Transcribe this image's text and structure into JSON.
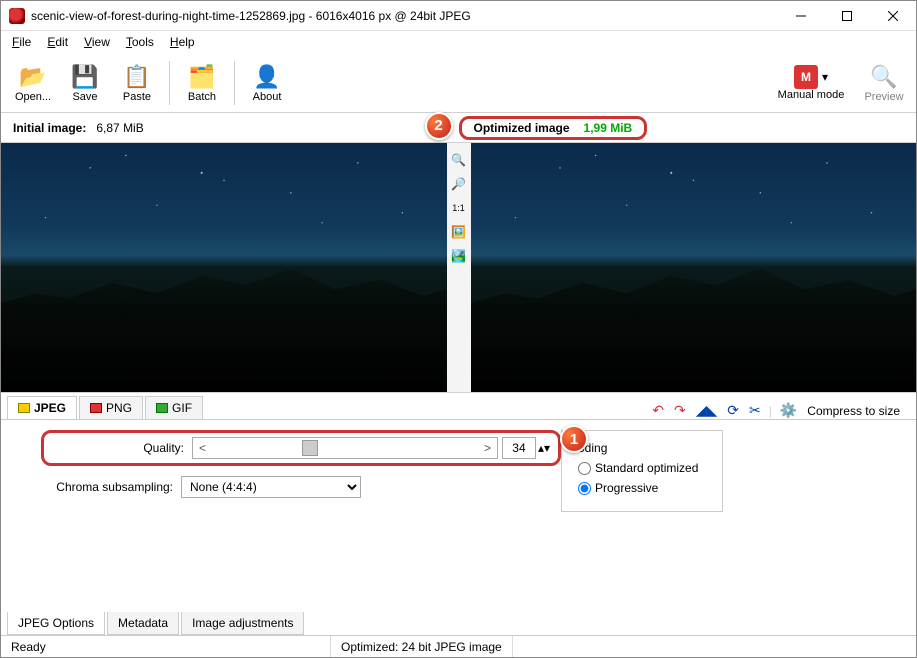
{
  "window": {
    "title": "scenic-view-of-forest-during-night-time-1252869.jpg - 6016x4016 px @ 24bit JPEG"
  },
  "menu": {
    "file": "File",
    "edit": "Edit",
    "view": "View",
    "tools": "Tools",
    "help": "Help"
  },
  "toolbar": {
    "open": "Open...",
    "save": "Save",
    "paste": "Paste",
    "batch": "Batch",
    "about": "About",
    "manual_mode": "Manual mode",
    "preview": "Preview"
  },
  "info": {
    "initial_label": "Initial image:",
    "initial_size": "6,87 MiB",
    "optimized_label": "Optimized image",
    "optimized_size": "1,99 MiB"
  },
  "badges": {
    "one": "1",
    "two": "2"
  },
  "center_tools": {
    "fit": "1:1"
  },
  "format_tabs": {
    "jpeg": "JPEG",
    "png": "PNG",
    "gif": "GIF"
  },
  "tab_toolbar": {
    "compress": "Compress to size"
  },
  "options": {
    "quality_label": "Quality:",
    "quality_value": "34",
    "chroma_label": "Chroma subsampling:",
    "chroma_value": "None (4:4:4)",
    "encoding_label": "oding",
    "radio_standard": "Standard optimized",
    "radio_progressive": "Progressive"
  },
  "bottom_tabs": {
    "jpeg": "JPEG Options",
    "meta": "Metadata",
    "adj": "Image adjustments"
  },
  "status": {
    "ready": "Ready",
    "opt": "Optimized: 24 bit JPEG image"
  }
}
